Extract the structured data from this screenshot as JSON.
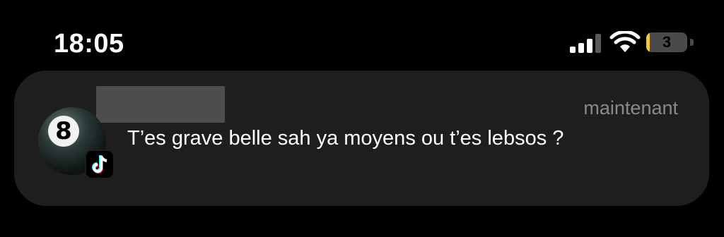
{
  "status_bar": {
    "time": "18:05",
    "signal_icon": "cellular-signal-icon",
    "wifi_icon": "wifi-icon",
    "battery_level": "3",
    "battery_fill_fraction": 0.03,
    "battery_color": "#f3c44a"
  },
  "notification": {
    "sender_redacted": true,
    "avatar_icon": "eight-ball-icon",
    "avatar_number": "8",
    "app_badge_icon": "tiktok-icon",
    "timestamp": "maintenant",
    "message": "T’es grave belle sah ya moyens ou t’es lebsos ?"
  }
}
